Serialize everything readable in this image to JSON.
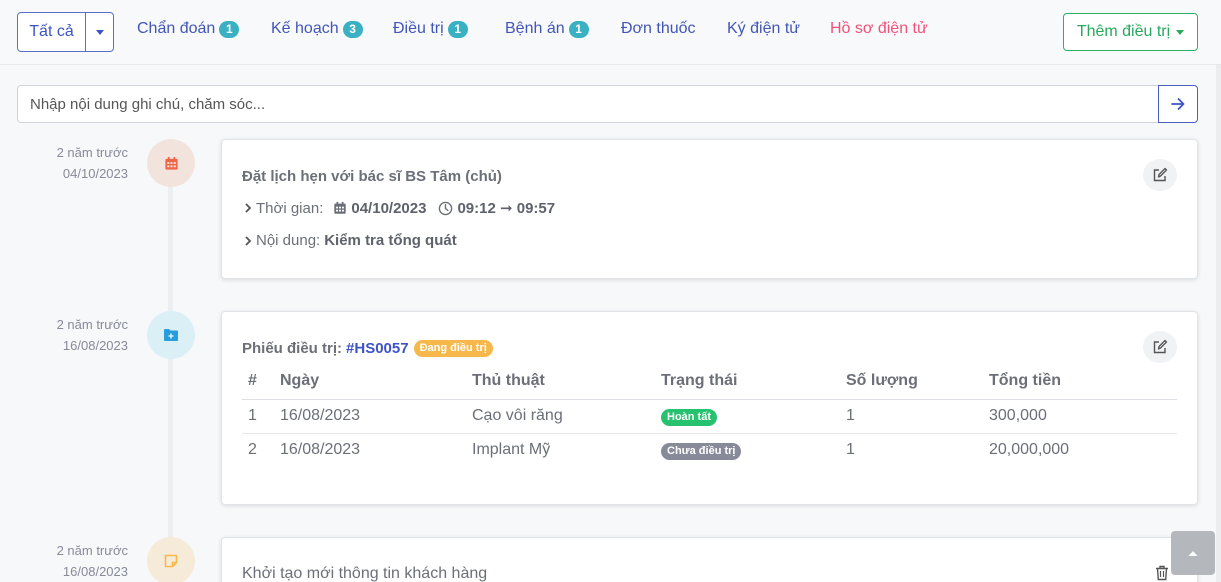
{
  "topnav": {
    "filter_label": "Tất cả",
    "tabs": [
      {
        "label": "Chẩn đoán",
        "count": "1"
      },
      {
        "label": "Kế hoạch",
        "count": "3"
      },
      {
        "label": "Điều trị",
        "count": "1"
      },
      {
        "label": "Bệnh án",
        "count": "1"
      },
      {
        "label": "Đơn thuốc"
      },
      {
        "label": "Ký điện tử"
      },
      {
        "label": "Hồ sơ điện tử"
      }
    ],
    "add_treatment_label": "Thêm điều trị",
    "colors": {
      "primary": "#3d55c4",
      "success": "#27a85c",
      "pink": "#f0527a",
      "count_badge": "#3ab0c3"
    }
  },
  "note": {
    "placeholder": "Nhập nội dung ghi chú, chăm sóc..."
  },
  "timeline": [
    {
      "ago": "2 năm trước",
      "date": "04/10/2023",
      "icon": "calendar-icon",
      "title": "Đặt lịch hẹn với bác sĩ BS Tâm (chủ)",
      "time_label": "Thời gian:",
      "appt_date": "04/10/2023",
      "appt_time": "09:12 ➞ 09:57",
      "content_label": "Nội dung:",
      "content_value": "Kiểm tra tổng quát"
    },
    {
      "ago": "2 năm trước",
      "date": "16/08/2023",
      "icon": "folder-plus-icon",
      "title_prefix": "Phiếu điều trị:",
      "code": "#HS0057",
      "status": "Đang điều trị",
      "table": {
        "headers": [
          "#",
          "Ngày",
          "Thủ thuật",
          "Trạng thái",
          "Số lượng",
          "Tổng tiền"
        ],
        "rows": [
          {
            "no": "1",
            "date": "16/08/2023",
            "procedure": "Cạo vôi răng",
            "status": "Hoàn tất",
            "qty": "1",
            "total": "300,000"
          },
          {
            "no": "2",
            "date": "16/08/2023",
            "procedure": "Implant Mỹ",
            "status": "Chưa điều trị",
            "qty": "1",
            "total": "20,000,000"
          }
        ]
      }
    },
    {
      "ago": "2 năm trước",
      "date": "16/08/2023",
      "icon": "sticky-note-icon",
      "title": "Khởi tạo mới thông tin khách hàng"
    }
  ]
}
